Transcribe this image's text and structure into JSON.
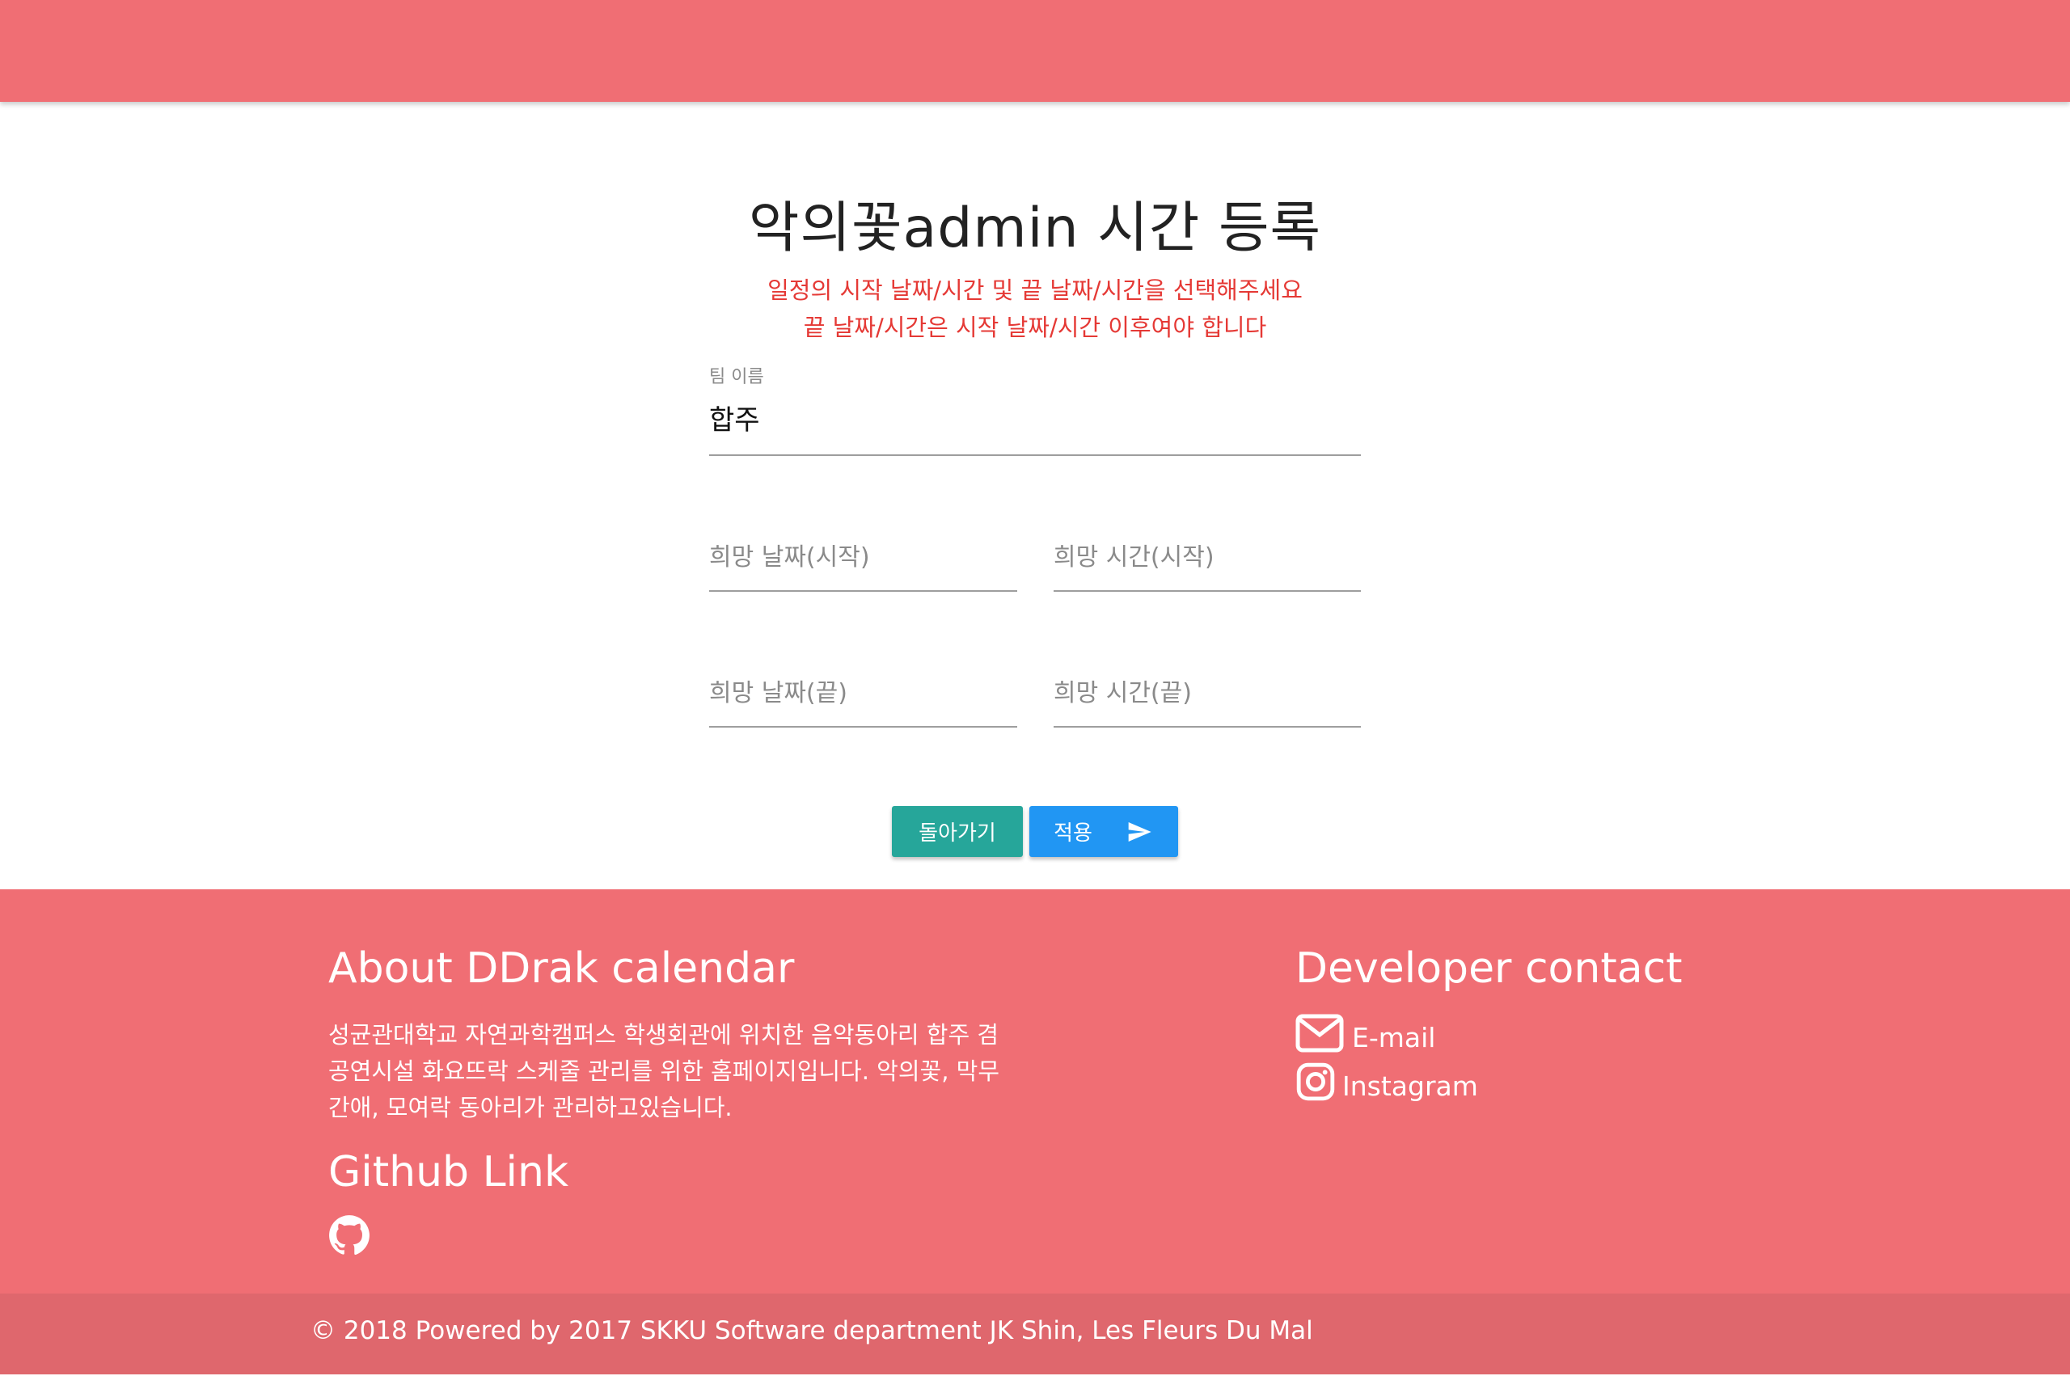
{
  "theme": {
    "header_bg": "#f06e74",
    "footer_bg": "#f06e74",
    "footer_copy_bg": "#df676d",
    "notice_color": "#e53935",
    "back_button_color": "#26a69a",
    "submit_button_color": "#2196f3"
  },
  "form": {
    "title": "악의꽃admin 시간 등록",
    "notice_line1": "일정의 시작 날짜/시간 및 끝 날짜/시간을 선택해주세요",
    "notice_line2": "끝 날짜/시간은 시작 날짜/시간 이후여야 합니다",
    "team_label": "팀 이름",
    "team_value": "합주",
    "start_date_placeholder": "희망 날짜(시작)",
    "start_time_placeholder": "희망 시간(시작)",
    "end_date_placeholder": "희망 날짜(끝)",
    "end_time_placeholder": "희망 시간(끝)",
    "back_label": "돌아가기",
    "submit_label": "적용",
    "submit_icon": "send-icon"
  },
  "footer": {
    "about_heading": "About DDrak calendar",
    "about_line1": "성균관대학교 자연과학캠퍼스 학생회관에 위치한 음악동아리 합주 겸",
    "about_line2": "공연시설 화요뜨락 스케줄 관리를 위한 홈페이지입니다. 악의꽃, 막무",
    "about_line3": "간애, 모여락 동아리가 관리하고있습니다.",
    "github_heading": "Github Link",
    "github_icon": "github-icon",
    "contact_heading": "Developer contact",
    "email_label": "E-mail",
    "email_icon": "mail-icon",
    "instagram_label": "Instagram",
    "instagram_icon": "instagram-icon",
    "copyright": "© 2018 Powered by 2017 SKKU Software department JK Shin, Les Fleurs Du Mal"
  }
}
